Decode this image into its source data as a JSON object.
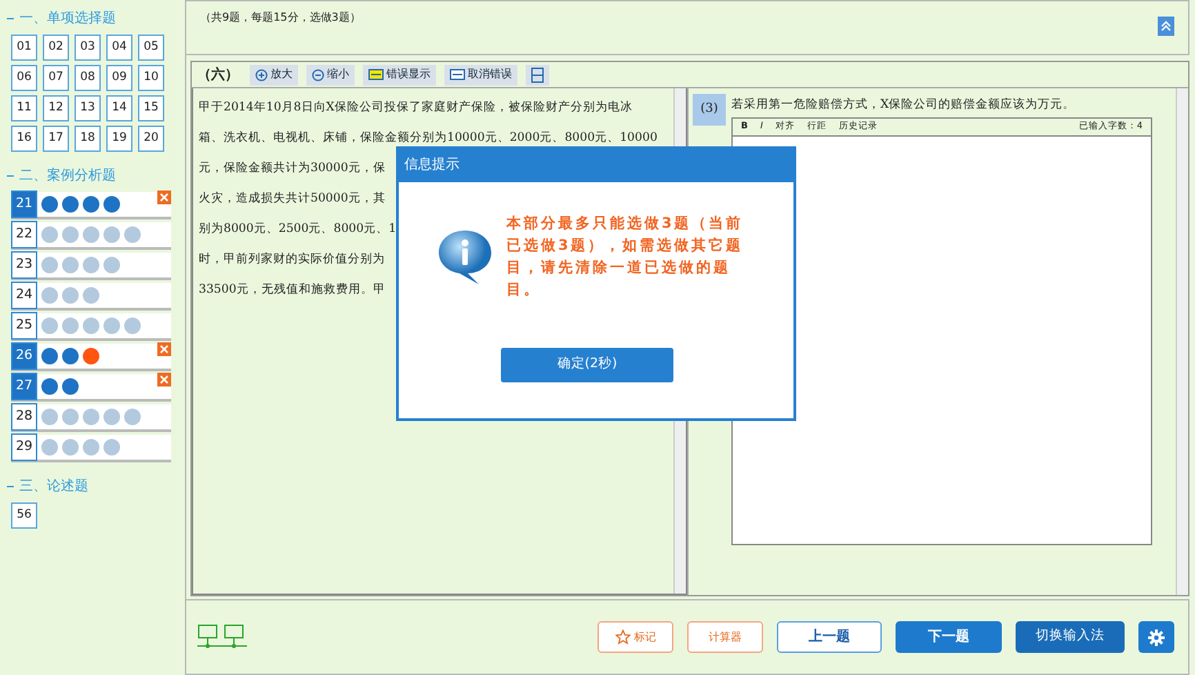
{
  "sidebar": {
    "sections": [
      {
        "title": "一、单项选择题",
        "kind": "grid",
        "items": [
          {
            "label": "01"
          },
          {
            "label": "02"
          },
          {
            "label": "03"
          },
          {
            "label": "04"
          },
          {
            "label": "05"
          },
          {
            "label": "06"
          },
          {
            "label": "07"
          },
          {
            "label": "08"
          },
          {
            "label": "09"
          },
          {
            "label": "10"
          },
          {
            "label": "11"
          },
          {
            "label": "12"
          },
          {
            "label": "13"
          },
          {
            "label": "14"
          },
          {
            "label": "15"
          },
          {
            "label": "16"
          },
          {
            "label": "17"
          },
          {
            "label": "18"
          },
          {
            "label": "19"
          },
          {
            "label": "20"
          }
        ]
      },
      {
        "title": "二、案例分析题",
        "kind": "case",
        "items": [
          {
            "label": "21",
            "selected": true,
            "removable": true,
            "dots": [
              {
                "color": "#1e73c5"
              },
              {
                "color": "#1e73c5"
              },
              {
                "color": "#1e73c5"
              },
              {
                "color": "#1e73c5"
              }
            ]
          },
          {
            "label": "22",
            "selected": false,
            "removable": false,
            "dots": [
              {
                "color": "#b3c9de"
              },
              {
                "color": "#b3c9de"
              },
              {
                "color": "#b3c9de"
              },
              {
                "color": "#b3c9de"
              },
              {
                "color": "#b3c9de"
              }
            ]
          },
          {
            "label": "23",
            "selected": false,
            "removable": false,
            "dots": [
              {
                "color": "#b3c9de"
              },
              {
                "color": "#b3c9de"
              },
              {
                "color": "#b3c9de"
              },
              {
                "color": "#b3c9de"
              }
            ]
          },
          {
            "label": "24",
            "selected": false,
            "removable": false,
            "dots": [
              {
                "color": "#b3c9de"
              },
              {
                "color": "#b3c9de"
              },
              {
                "color": "#b3c9de"
              }
            ]
          },
          {
            "label": "25",
            "selected": false,
            "removable": false,
            "dots": [
              {
                "color": "#b3c9de"
              },
              {
                "color": "#b3c9de"
              },
              {
                "color": "#b3c9de"
              },
              {
                "color": "#b3c9de"
              },
              {
                "color": "#b3c9de"
              }
            ]
          },
          {
            "label": "26",
            "selected": true,
            "removable": true,
            "dots": [
              {
                "color": "#1e73c5"
              },
              {
                "color": "#1e73c5"
              },
              {
                "color": "#ff5511"
              }
            ]
          },
          {
            "label": "27",
            "selected": true,
            "removable": true,
            "dots": [
              {
                "color": "#1e73c5"
              },
              {
                "color": "#1e73c5"
              }
            ]
          },
          {
            "label": "28",
            "selected": false,
            "removable": false,
            "dots": [
              {
                "color": "#b3c9de"
              },
              {
                "color": "#b3c9de"
              },
              {
                "color": "#b3c9de"
              },
              {
                "color": "#b3c9de"
              },
              {
                "color": "#b3c9de"
              }
            ]
          },
          {
            "label": "29",
            "selected": false,
            "removable": false,
            "dots": [
              {
                "color": "#b3c9de"
              },
              {
                "color": "#b3c9de"
              },
              {
                "color": "#b3c9de"
              },
              {
                "color": "#b3c9de"
              }
            ]
          }
        ]
      },
      {
        "title": "三、论述题",
        "kind": "grid",
        "items": [
          {
            "label": "56"
          }
        ]
      }
    ]
  },
  "header": {
    "text": "（共9题，每题15分，选做3题）"
  },
  "passage": {
    "number": "（六）",
    "tools": [
      {
        "kind": "zoom-in",
        "label": "放大"
      },
      {
        "kind": "zoom-out",
        "label": "缩小"
      },
      {
        "kind": "highlight",
        "label": "错误显示"
      },
      {
        "kind": "clear",
        "label": "取消错误"
      },
      {
        "kind": "split"
      }
    ],
    "lines": [
      "甲于2014年10月8日向X保险公司投保了家庭财产保险，被保险财产分别为电冰",
      "箱、洗衣机、电视机、床铺，保险金额分别为10000元、2000元、8000元、10000",
      "元，保险金额共计为30000元，保",
      "火灾，造成损失共计50000元，其",
      "别为8000元、2500元、8000元、1",
      "时，甲前列家财的实际价值分别为",
      "33500元，无残值和施救费用。甲"
    ]
  },
  "question": {
    "number": "(3)",
    "text": "若采用第一危险赔偿方式，X保险公司的赔偿金额应该为万元。",
    "editor": {
      "tools": [
        {
          "kind": "bold",
          "label": "B"
        },
        {
          "kind": "italic",
          "label": "I"
        },
        {
          "kind": "text",
          "label": "对齐"
        },
        {
          "kind": "text",
          "label": "行距"
        },
        {
          "kind": "text",
          "label": "历史记录"
        }
      ],
      "count": "已输入字数：4"
    }
  },
  "dialog": {
    "title": "信息提示",
    "message": "本部分最多只能选做3题（当前已选做3题），如需选做其它题目，请先清除一道已选做的题目。",
    "button": "确定(2秒)"
  },
  "footer": {
    "buttons": [
      {
        "kind": "mark",
        "label": "标记"
      },
      {
        "kind": "calc",
        "label": "计算器"
      },
      {
        "kind": "prev",
        "label": "上一题"
      },
      {
        "kind": "next",
        "label": "下一题"
      },
      {
        "kind": "ime",
        "label": "切换输入法"
      },
      {
        "kind": "settings"
      }
    ]
  }
}
